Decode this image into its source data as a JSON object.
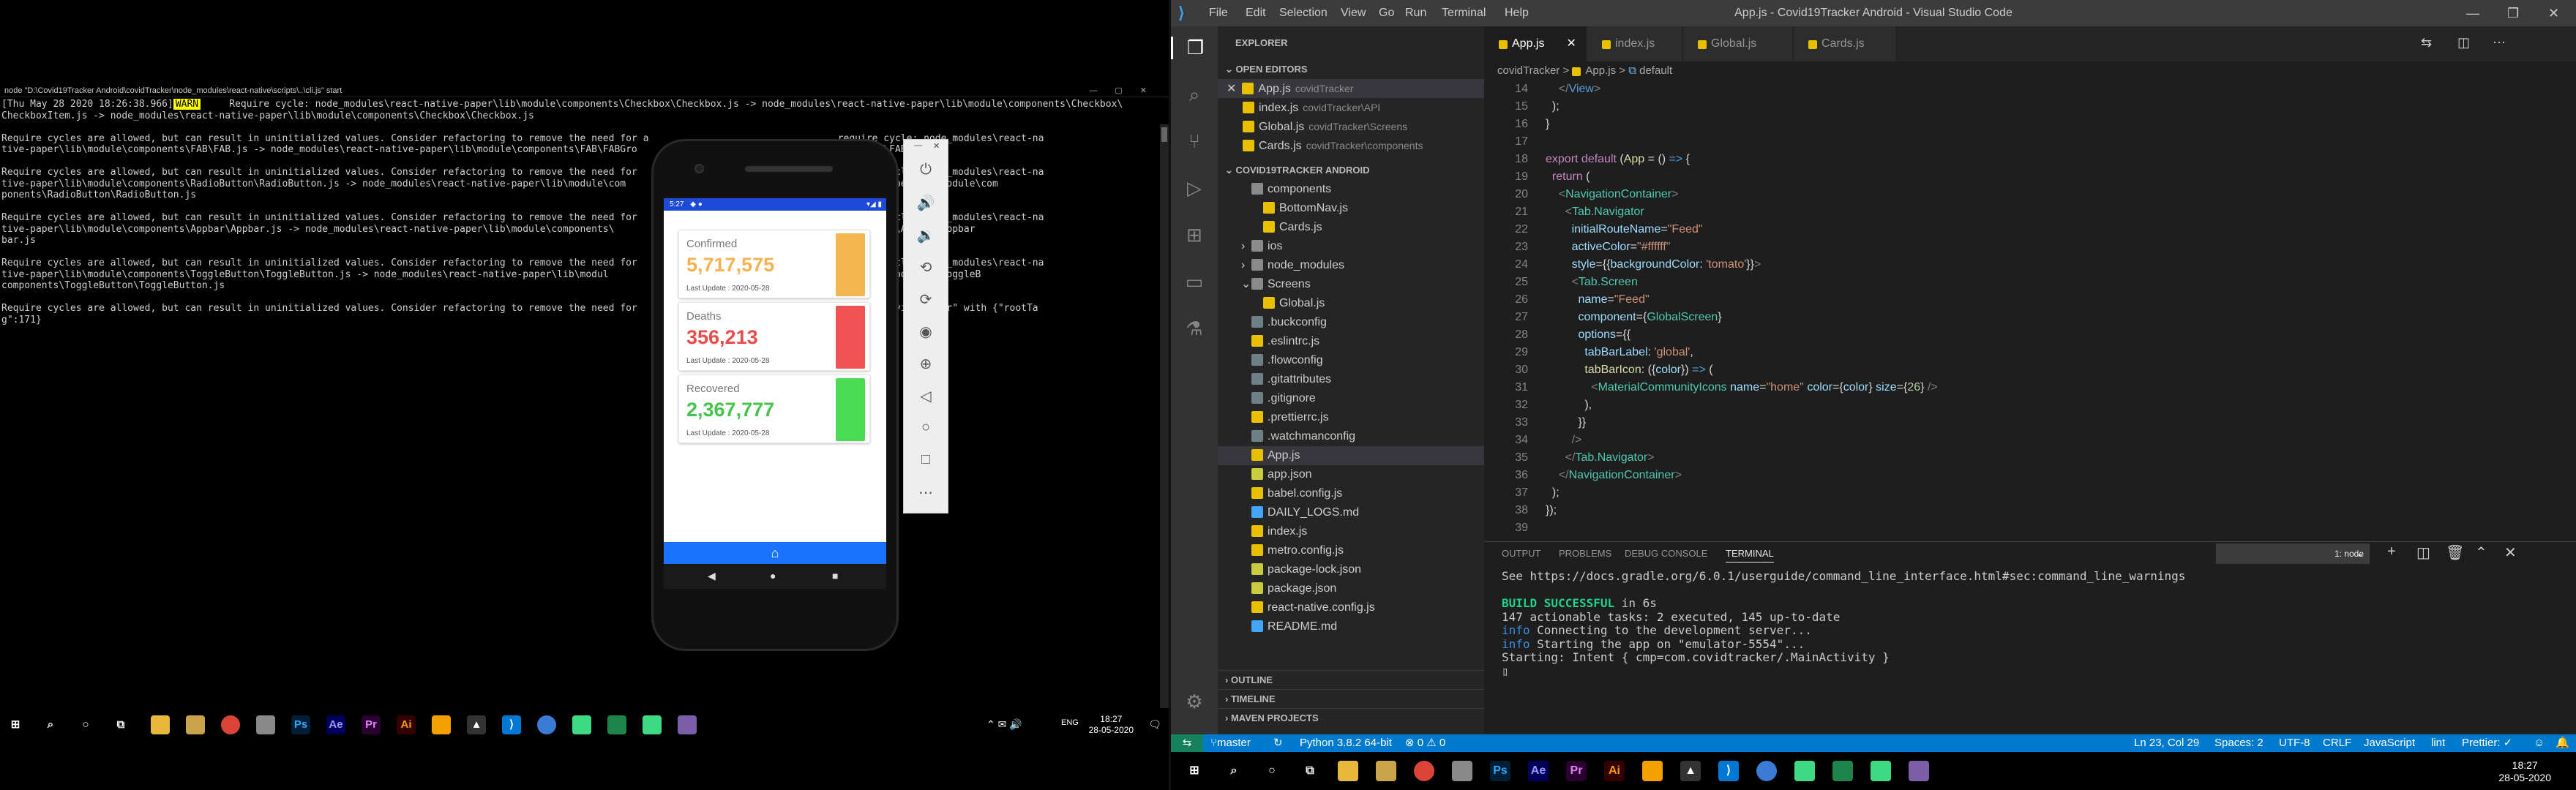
{
  "left_console": {
    "title": "node \"D:\\Covid19Tracker Android\\covidTracker\\node_modules\\react-native\\scripts\\..\\cli.js\" start",
    "warn_tag": "WARN",
    "lines": [
      "[Thu May 28 2020 18:26:38.966]",
      "     Require cycle: node_modules\\react-native-paper\\lib\\module\\components\\Checkbox\\Checkbox.js -> node_modules\\react-native-paper\\lib\\module\\components\\Checkbox\\",
      "CheckboxItem.js -> node_modules\\react-native-paper\\lib\\module\\components\\Checkbox\\Checkbox.js",
      "",
      "Require cycles are allowed, but can result in uninitialized values. Consider refactoring to remove the need for a                                 require cycle: node_modules\\react-na",
      "tive-paper\\lib\\module\\components\\FAB\\FAB.js -> node_modules\\react-native-paper\\lib\\module\\components\\FAB\\FABGro                            \\components\\FAB\\FAB.js",
      "",
      "Require cycles are allowed, but can result in uninitialized values. Consider refactoring to remove the need for                                   require cycle: node_modules\\react-na",
      "tive-paper\\lib\\module\\components\\RadioButton\\RadioButton.js -> node_modules\\react-native-paper\\lib\\module\\com                            les\\react-native-paper\\lib\\module\\com",
      "ponents\\RadioButton\\RadioButton.js",
      "",
      "Require cycles are allowed, but can result in uninitialized values. Consider refactoring to remove the need for                                   require cycle: node_modules\\react-na",
      "tive-paper\\lib\\module\\components\\Appbar\\Appbar.js -> node_modules\\react-native-paper\\lib\\module\\components\\                            lib\\module\\components\\Appbar\\Appbar",
      "bar.js",
      "",
      "Require cycles are allowed, but can result in uninitialized values. Consider refactoring to remove the need for                                   require cycle: node_modules\\react-na",
      "tive-paper\\lib\\module\\components\\ToggleButton\\ToggleButton.js -> node_modules\\react-native-paper\\lib\\modul                            e-paper\\lib\\module\\components\\ToggleB",
      "components\\ToggleButton\\ToggleButton.js",
      "",
      "Require cycles are allowed, but can result in uninitialized values. Consider refactoring to remove the need for                                   unning \"coyidTracker\" with {\"rootTa",
      "g\":171}"
    ]
  },
  "phone": {
    "status_time": "5:27",
    "status_icons": "◆ ●",
    "status_right": "▾◢ ▮",
    "cards": [
      {
        "label": "Confirmed",
        "value": "5,717,575",
        "update": "Last Update : 2020-05-28",
        "color": "#f4b350",
        "bar": "#f5b551"
      },
      {
        "label": "Deaths",
        "value": "356,213",
        "update": "Last Update : 2020-05-28",
        "color": "#e94b4b",
        "bar": "#ef5353"
      },
      {
        "label": "Recovered",
        "value": "2,367,777",
        "update": "Last Update : 2020-05-28",
        "color": "#44c44a",
        "bar": "#4cdc54"
      }
    ],
    "tab_icon": "⌂"
  },
  "emulator_toolbar": {
    "close": "✕",
    "minimize": "—"
  },
  "left_taskbar": {
    "time": "18:27",
    "date": "28-05-2020",
    "lang": "ENG"
  },
  "vscode": {
    "window_title": "App.js - Covid19Tracker Android - Visual Studio Code",
    "menu": [
      "File",
      "Edit",
      "Selection",
      "View",
      "Go",
      "Run",
      "Terminal",
      "Help"
    ],
    "explorer_title": "EXPLORER",
    "open_editors_header": "OPEN EDITORS",
    "project_header": "COVID19TRACKER ANDROID",
    "open_editors": [
      {
        "name": "App.js",
        "desc": "covidTracker",
        "close": "✕"
      },
      {
        "name": "index.js",
        "desc": "covidTracker\\API"
      },
      {
        "name": "Global.js",
        "desc": "covidTracker\\Screens"
      },
      {
        "name": "Cards.js",
        "desc": "covidTracker\\components"
      }
    ],
    "tree": [
      {
        "name": "components",
        "indent": 1
      },
      {
        "name": "BottomNav.js",
        "indent": 2
      },
      {
        "name": "Cards.js",
        "indent": 2
      },
      {
        "name": "ios",
        "indent": 1,
        "arrow": "›"
      },
      {
        "name": "node_modules",
        "indent": 1,
        "arrow": "›"
      },
      {
        "name": "Screens",
        "indent": 1,
        "arrow": "⌄"
      },
      {
        "name": "Global.js",
        "indent": 2
      },
      {
        "name": ".buckconfig",
        "indent": 1
      },
      {
        "name": ".eslintrc.js",
        "indent": 1
      },
      {
        "name": ".flowconfig",
        "indent": 1
      },
      {
        "name": ".gitattributes",
        "indent": 1
      },
      {
        "name": ".gitignore",
        "indent": 1
      },
      {
        "name": ".prettierrc.js",
        "indent": 1
      },
      {
        "name": ".watchmanconfig",
        "indent": 1
      },
      {
        "name": "App.js",
        "indent": 1
      },
      {
        "name": "app.json",
        "indent": 1
      },
      {
        "name": "babel.config.js",
        "indent": 1
      },
      {
        "name": "DAILY_LOGS.md",
        "indent": 1
      },
      {
        "name": "index.js",
        "indent": 1
      },
      {
        "name": "metro.config.js",
        "indent": 1
      },
      {
        "name": "package-lock.json",
        "indent": 1
      },
      {
        "name": "package.json",
        "indent": 1
      },
      {
        "name": "react-native.config.js",
        "indent": 1
      },
      {
        "name": "README.md",
        "indent": 1
      }
    ],
    "bottom_sections": [
      "OUTLINE",
      "TIMELINE",
      "MAVEN PROJECTS"
    ],
    "tabs": [
      "App.js",
      "index.js",
      "Global.js",
      "Cards.js"
    ],
    "breadcrumb": [
      "covidTracker",
      ">",
      "App.js",
      ">",
      "default"
    ],
    "line_numbers": [
      "14",
      "15",
      "16",
      "17",
      "18",
      "19",
      "20",
      "21",
      "22",
      "23",
      "24",
      "25",
      "26",
      "27",
      "28",
      "29",
      "30",
      "31",
      "32",
      "33",
      "34",
      "35",
      "36",
      "37",
      "38",
      "39"
    ],
    "panel_tabs": [
      "OUTPUT",
      "PROBLEMS",
      "DEBUG CONSOLE",
      "TERMINAL"
    ],
    "terminal_select": "1: node",
    "terminal": {
      "line1": "See https://docs.gradle.org/6.0.1/userguide/command_line_interface.html#sec:command_line_warnings",
      "build_ok": "BUILD SUCCESSFUL",
      "build_time": " in 6s",
      "tasks": "147 actionable tasks: 2 executed, 145 up-to-date",
      "info": "info",
      "info1": " Connecting to the development server...",
      "info2": " Starting the app on \"emulator-5554\"...",
      "starting": "Starting: Intent { cmp=com.covidtracker/.MainActivity }",
      "cursor": "▯"
    },
    "status": {
      "branch": "master",
      "python": "Python 3.8.2 64-bit",
      "problems": "⊗ 0  ⚠ 0",
      "position": "Ln 23, Col 29",
      "spaces": "Spaces: 2",
      "encoding": "UTF-8",
      "eol": "CRLF",
      "language": "JavaScript",
      "lint": "lint",
      "prettier": "Prettier: ✓",
      "sync": "↻"
    },
    "taskbar": {
      "time": "18:27",
      "date": "28-05-2020"
    }
  }
}
